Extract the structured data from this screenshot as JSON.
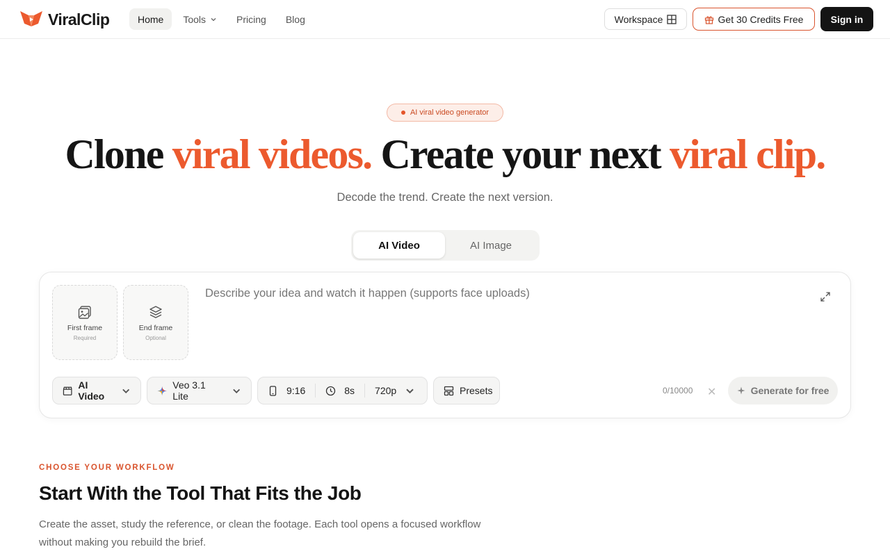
{
  "brand": {
    "name": "ViralClip",
    "logo_color": "#ec5a2e"
  },
  "nav": {
    "items": [
      {
        "label": "Home",
        "active": true
      },
      {
        "label": "Tools",
        "dropdown": true
      },
      {
        "label": "Pricing"
      },
      {
        "label": "Blog"
      }
    ]
  },
  "header_actions": {
    "workspace_label": "Workspace",
    "credits_label": "Get 30 Credits Free",
    "signin_label": "Sign in"
  },
  "hero": {
    "badge": "AI viral video generator",
    "headline_parts": [
      "Clone ",
      "viral videos.",
      " Create your next ",
      "viral clip."
    ],
    "subhead": "Decode the trend. Create the next version.",
    "accent_color": "#ec5a2e"
  },
  "mode_tabs": [
    {
      "label": "AI Video",
      "active": true
    },
    {
      "label": "AI Image",
      "active": false
    }
  ],
  "composer": {
    "first_frame": {
      "title": "First frame",
      "sub": "Required",
      "icon": "image-icon"
    },
    "end_frame": {
      "title": "End frame",
      "sub": "Optional",
      "icon": "layers-icon"
    },
    "placeholder": "Describe your idea and watch it happen (supports face uploads)",
    "type_label": "AI Video",
    "model_label": "Veo 3.1 Lite",
    "aspect": "9:16",
    "duration": "8s",
    "resolution": "720p",
    "presets_label": "Presets",
    "counter": "0/10000",
    "generate_label": "Generate for free"
  },
  "workflow": {
    "eyebrow": "CHOOSE YOUR WORKFLOW",
    "title": "Start With the Tool That Fits the Job",
    "description": "Create the asset, study the reference, or clean the footage. Each tool opens a focused workflow without making you rebuild the brief."
  }
}
